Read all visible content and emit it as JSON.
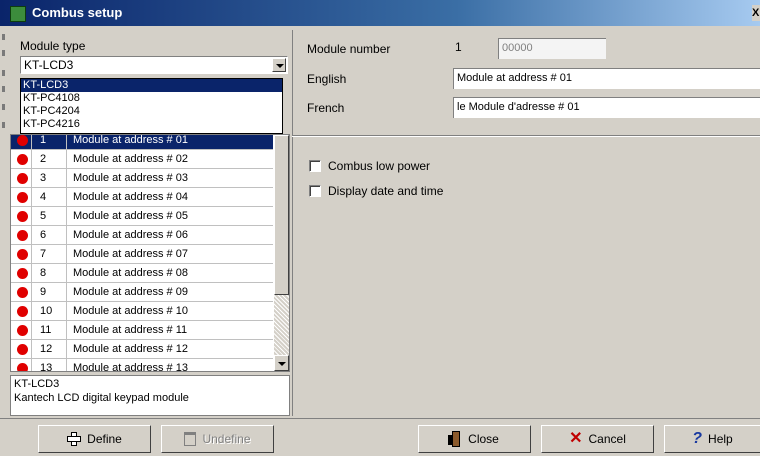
{
  "window": {
    "title": "Combus setup",
    "close_glyph": "X"
  },
  "left": {
    "module_type_label": "Module type",
    "selected_type": "KT-LCD3",
    "dropdown_options": [
      "KT-LCD3",
      "KT-PC4108",
      "KT-PC4204",
      "KT-PC4216"
    ],
    "modules": [
      {
        "num": "1",
        "name": "Module at address # 01"
      },
      {
        "num": "2",
        "name": "Module at address # 02"
      },
      {
        "num": "3",
        "name": "Module at address # 03"
      },
      {
        "num": "4",
        "name": "Module at address # 04"
      },
      {
        "num": "5",
        "name": "Module at address # 05"
      },
      {
        "num": "6",
        "name": "Module at address # 06"
      },
      {
        "num": "7",
        "name": "Module at address # 07"
      },
      {
        "num": "8",
        "name": "Module at address # 08"
      },
      {
        "num": "9",
        "name": "Module at address # 09"
      },
      {
        "num": "10",
        "name": "Module at address # 10"
      },
      {
        "num": "11",
        "name": "Module at address # 11"
      },
      {
        "num": "12",
        "name": "Module at address # 12"
      },
      {
        "num": "13",
        "name": "Module at address # 13"
      }
    ],
    "status_color": "#e00000",
    "description_line1": "KT-LCD3",
    "description_line2": "Kantech LCD digital keypad module"
  },
  "right": {
    "module_number_label": "Module number",
    "module_number_value": "1",
    "module_serial": "00000",
    "english_label": "English",
    "english_value": "Module at address # 01",
    "french_label": "French",
    "french_value": "le Module d'adresse # 01",
    "combus_low_power_label": "Combus low power",
    "display_date_time_label": "Display date and time"
  },
  "buttons": {
    "define": "Define",
    "undefine": "Undefine",
    "close": "Close",
    "cancel": "Cancel",
    "help": "Help"
  },
  "icons": {
    "define": "plus-icon",
    "undefine": "trash-icon",
    "close": "door-icon",
    "cancel": "x-icon",
    "help": "question-icon"
  }
}
